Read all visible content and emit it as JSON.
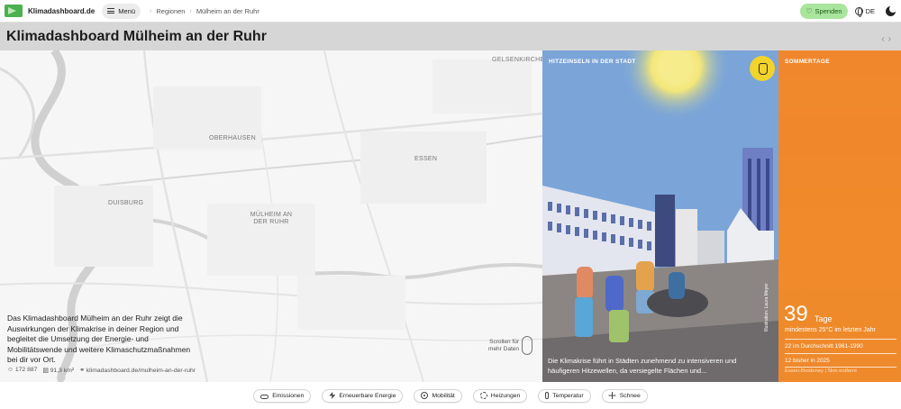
{
  "header": {
    "site_name": "Klimadashboard.de",
    "menu_label": "Menü",
    "breadcrumb": [
      "Regionen",
      "Mülheim an der Ruhr"
    ],
    "donate_label": "Spenden",
    "language": "DE",
    "icons": [
      "logo-icon",
      "menu-icon",
      "heart-icon",
      "globe-icon",
      "dark-mode-icon"
    ]
  },
  "title_bar": {
    "title": "Klimadashboard Mülheim an der Ruhr",
    "prev_label": "‹",
    "next_label": "›"
  },
  "map": {
    "city_labels": [
      "GELSENKIRCHEN",
      "OBERHAUSEN",
      "ESSEN",
      "DUISBURG",
      "MÜLHEIM AN DER RUHR"
    ],
    "intro": "Das Klimadashboard Mülheim an der Ruhr zeigt die Auswirkungen der Klimakrise in deiner Region und begleitet die Umsetzung der Energie- und Mobilitätswende und weitere Klimaschutzmaßnahmen bei dir vor Ort.",
    "population": "172 887",
    "area": "91,3 km²",
    "link": "klimadashboard.de/mulheim-an-der-ruhr",
    "scroll_hint": "Scrollen für mehr Daten"
  },
  "heat_card": {
    "label": "HITZEINSELN IN DER STADT",
    "caption": "Die Klimakrise führt in Städten zunehmend zu intensiveren und häufigeren Hitzewellen, da versiegelte Flächen und...",
    "credit": "Illustration: Laura Meyer",
    "colors": {
      "sky": "#7aa6d9",
      "ground": "#8f8a88",
      "sun": "#f3e67a"
    }
  },
  "summer_card": {
    "label": "SOMMERTAGE",
    "value": "39",
    "unit": "Tage",
    "description": "mindestens 25°C im letzten Jahr",
    "average": "22 im Durchschnitt 1961-1990",
    "this_year": "12 bisher in 2025",
    "station": "Essen-Bredeney | 5km entfernt",
    "color": "#f0872c"
  },
  "tabs": [
    {
      "label": "Emissionen",
      "icon": "cloud-icon"
    },
    {
      "label": "Erneuerbare Energie",
      "icon": "bolt-icon"
    },
    {
      "label": "Mobilität",
      "icon": "wheel-icon"
    },
    {
      "label": "Heizungen",
      "icon": "heat-icon"
    },
    {
      "label": "Temperatur",
      "icon": "thermometer-icon"
    },
    {
      "label": "Schnee",
      "icon": "snowflake-icon"
    }
  ]
}
